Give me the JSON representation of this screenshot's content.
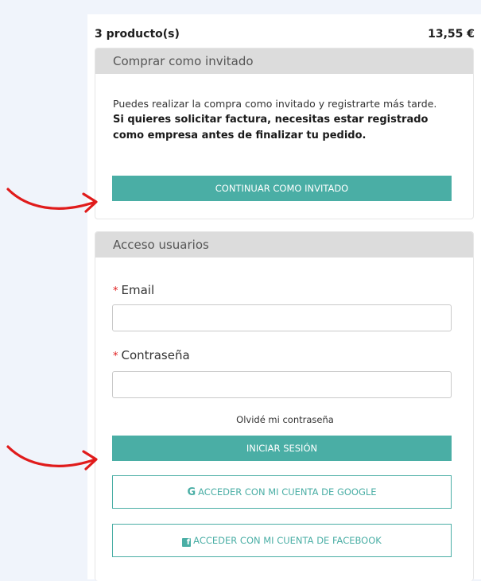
{
  "cart": {
    "count_label": "3 producto(s)",
    "total": "13,55 €"
  },
  "guest": {
    "header": "Comprar como invitado",
    "text": "Puedes realizar la compra como invitado y registrarte más tarde.",
    "strong_text": "Si quieres solicitar factura, necesitas estar registrado como empresa antes de finalizar tu pedido.",
    "button_label": "CONTINUAR COMO INVITADO"
  },
  "login": {
    "header": "Acceso usuarios",
    "required_mark": "*",
    "email_label": "Email",
    "email_value": "",
    "password_label": "Contraseña",
    "password_value": "",
    "forgot_label": "Olvidé mi contraseña",
    "submit_label": "INICIAR SESIÓN",
    "google_icon": "G",
    "google_label": "ACCEDER CON MI CUENTA DE GOOGLE",
    "facebook_icon": "f",
    "facebook_label": "ACCEDER CON MI CUENTA DE FACEBOOK"
  },
  "colors": {
    "accent": "#4aaea5",
    "annotation_arrow": "#e01b1b",
    "panel_header_bg": "#dcdcdc",
    "page_bg": "#f0f4fb"
  },
  "icons": {
    "annotation": "curved-arrow-icon",
    "google": "google-icon",
    "facebook": "facebook-icon"
  }
}
